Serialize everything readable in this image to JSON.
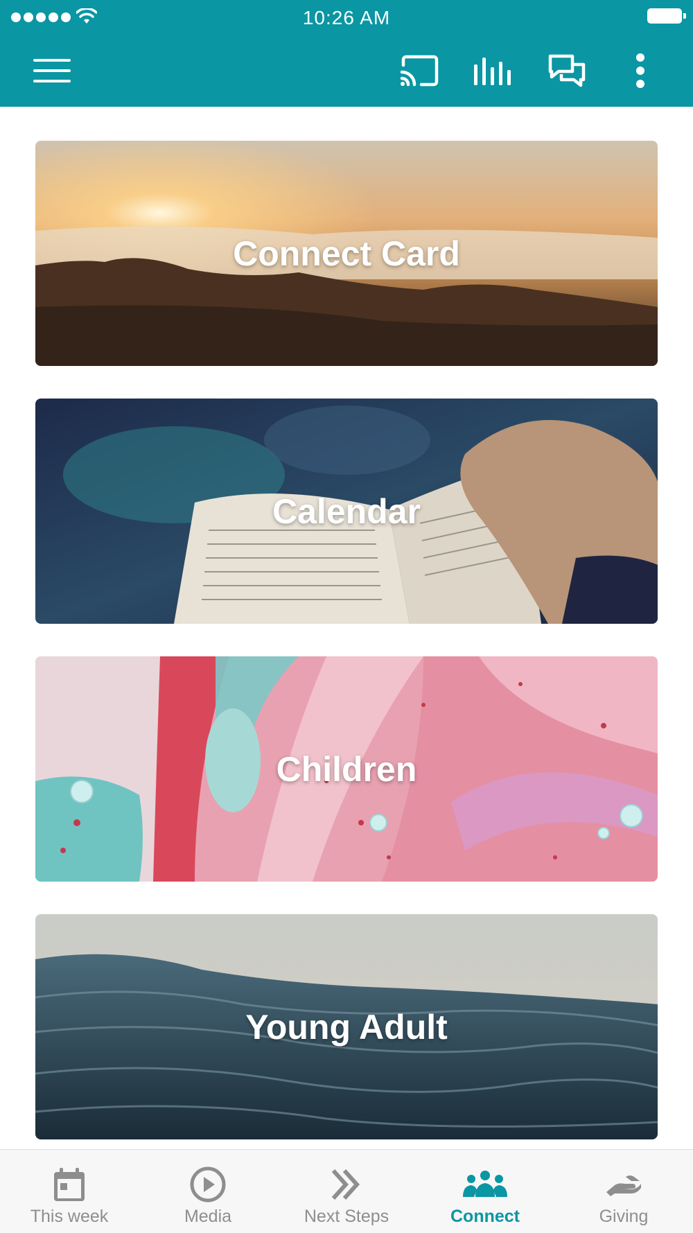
{
  "status_bar": {
    "time": "10:26 AM",
    "signal_icon": "signal-dots-icon",
    "wifi_icon": "wifi-icon",
    "battery_icon": "battery-icon"
  },
  "toolbar": {
    "menu_icon": "hamburger-menu-icon",
    "actions": [
      "cast-icon",
      "bar-chart-icon",
      "chat-bubbles-icon",
      "more-vertical-icon"
    ],
    "background": "#0a96a3"
  },
  "cards": [
    {
      "title": "Connect Card"
    },
    {
      "title": "Calendar"
    },
    {
      "title": "Children"
    },
    {
      "title": "Young Adult"
    }
  ],
  "tabs": [
    {
      "label": "This week",
      "icon": "calendar-icon"
    },
    {
      "label": "Media",
      "icon": "play-circle-icon"
    },
    {
      "label": "Next Steps",
      "icon": "double-chevron-icon"
    },
    {
      "label": "Connect",
      "icon": "people-group-icon",
      "active": true
    },
    {
      "label": "Giving",
      "icon": "giving-hand-icon"
    }
  ],
  "colors": {
    "accent": "#0a96a3",
    "inactive_tab": "#8e8e8e"
  }
}
